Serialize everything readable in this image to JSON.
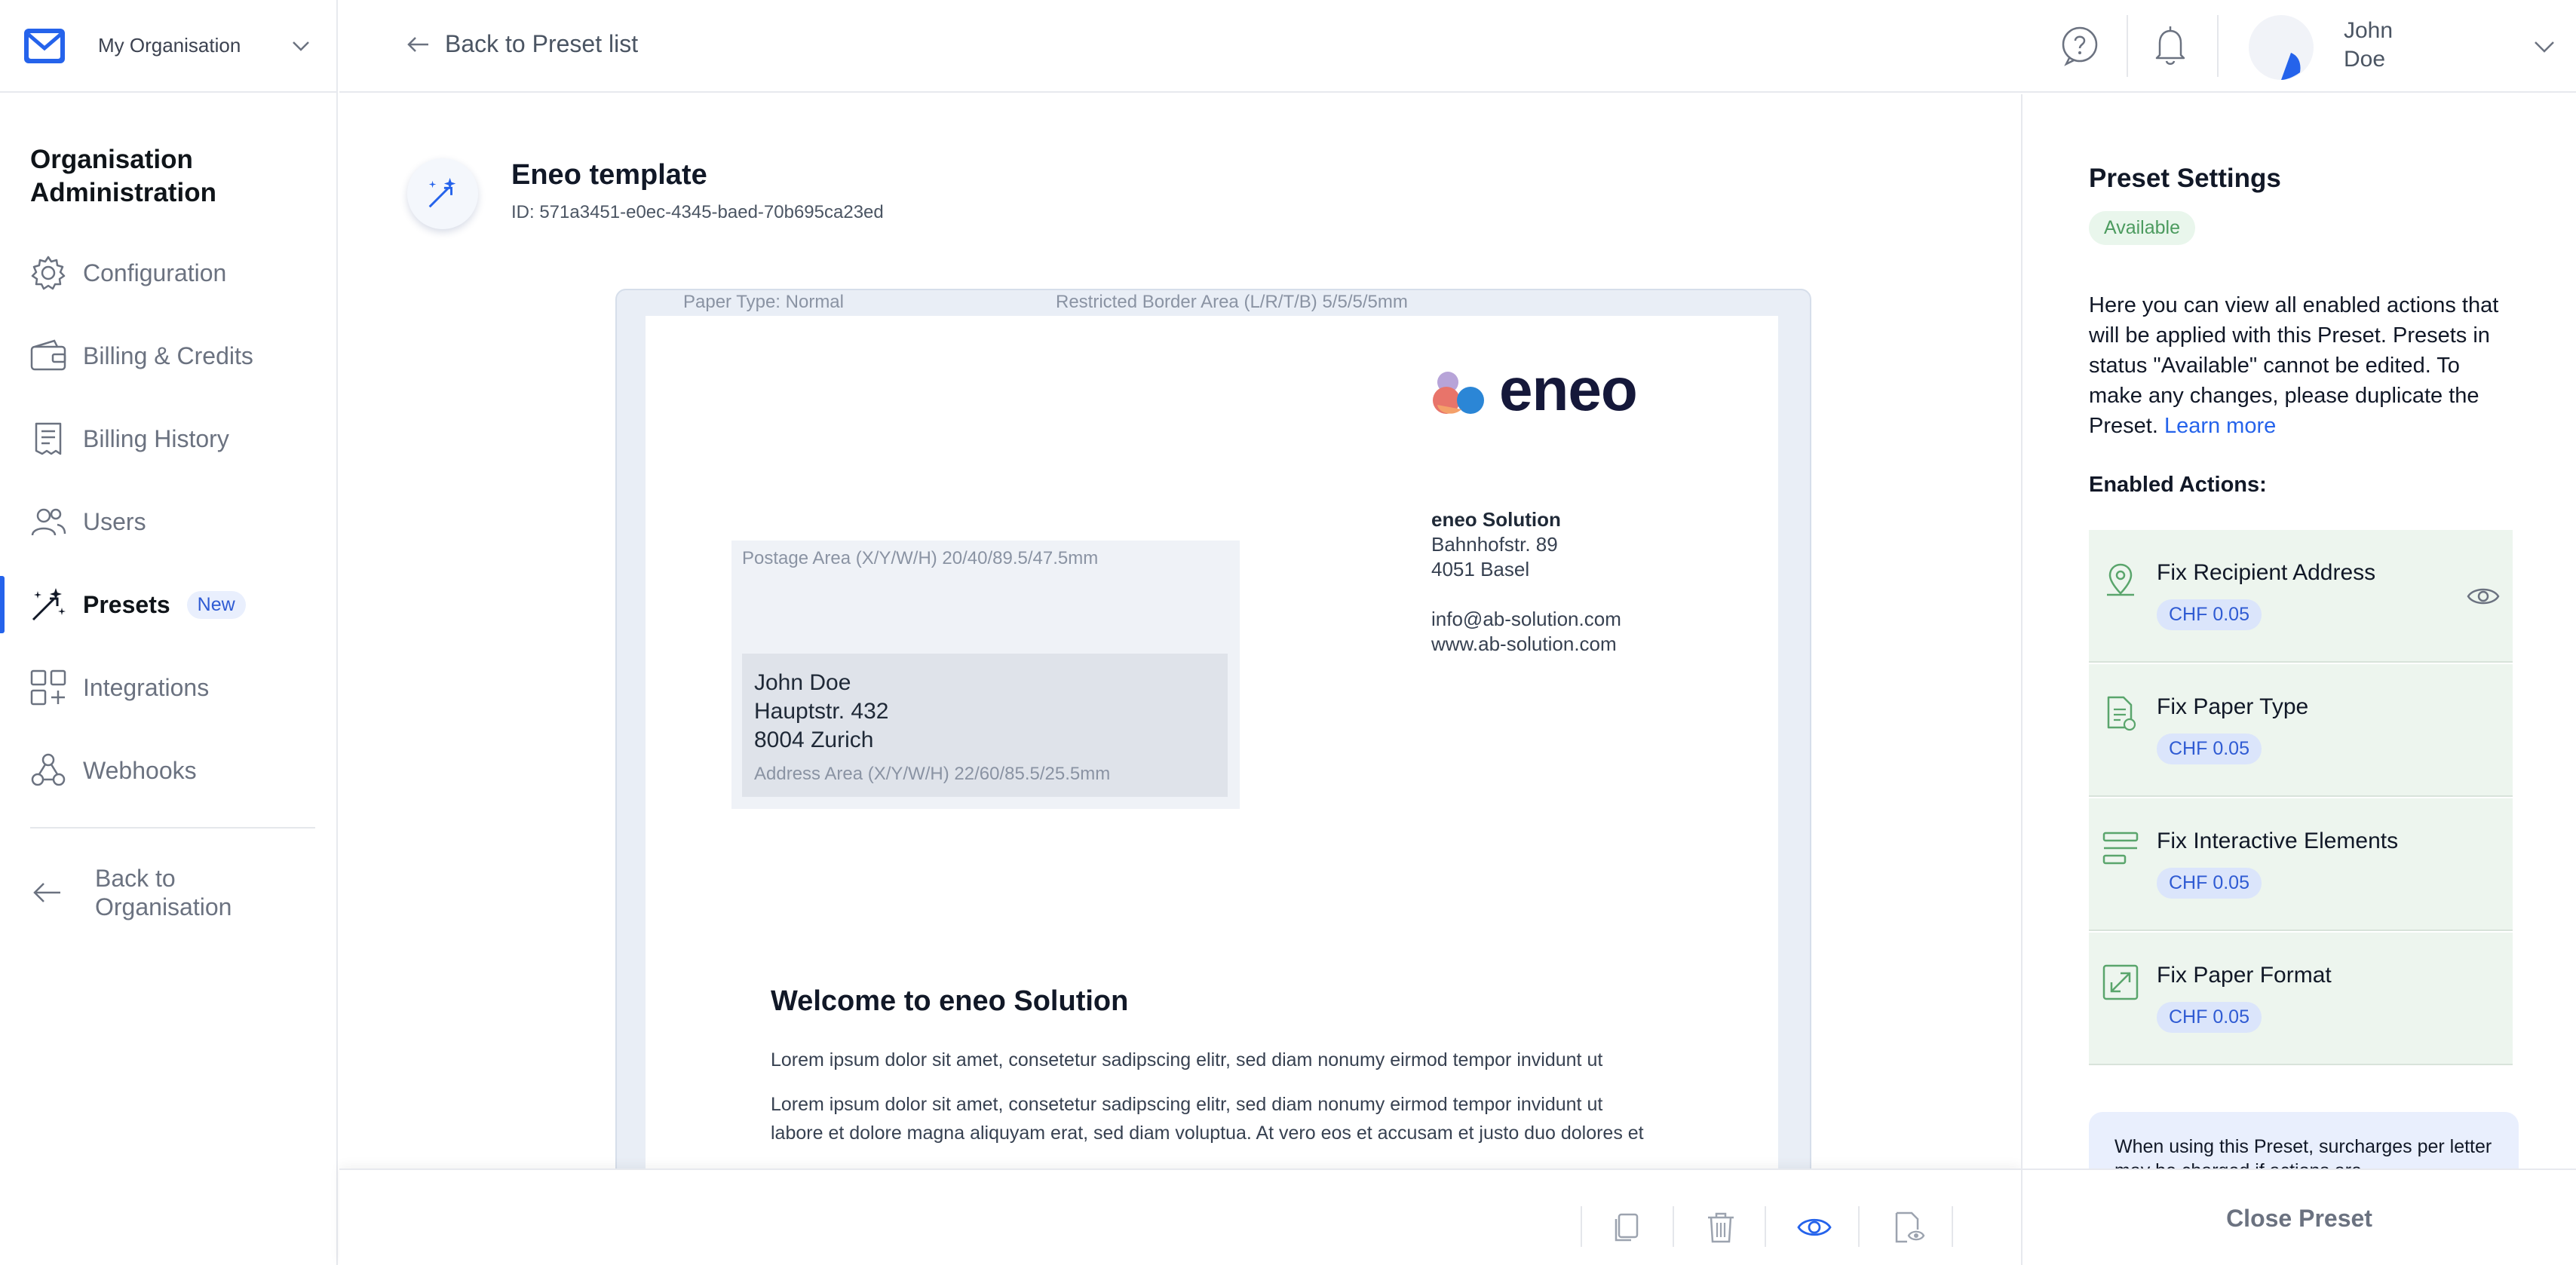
{
  "sidebar": {
    "org_name": "My Organisation",
    "section_title": "Organisation Administration",
    "items": [
      {
        "label": "Configuration",
        "icon": "gear-icon"
      },
      {
        "label": "Billing & Credits",
        "icon": "wallet-icon"
      },
      {
        "label": "Billing History",
        "icon": "receipt-icon"
      },
      {
        "label": "Users",
        "icon": "users-icon"
      },
      {
        "label": "Presets",
        "icon": "magic-wand-icon",
        "badge": "New",
        "active": true
      },
      {
        "label": "Integrations",
        "icon": "grid-plus-icon"
      },
      {
        "label": "Webhooks",
        "icon": "webhook-icon"
      }
    ],
    "back_label": "Back to Organisation"
  },
  "topbar": {
    "back_label": "Back to Preset list",
    "user_name": "John Doe"
  },
  "template": {
    "title": "Eneo template",
    "id_text": "ID: 571a3451-e0ec-4345-baed-70b695ca23ed"
  },
  "document": {
    "paper_type": "Paper Type: Normal",
    "border_area": "Restricted Border Area (L/R/T/B) 5/5/5/5mm",
    "logo_text": "eneo",
    "sender": {
      "name": "eneo Solution",
      "street": "Bahnhofstr. 89",
      "city": "4051 Basel",
      "email": "info@ab-solution.com",
      "web": "www.ab-solution.com"
    },
    "postage_label": "Postage Area (X/Y/W/H) 20/40/89.5/47.5mm",
    "recipient": {
      "name": "John Doe",
      "street": "Hauptstr. 432",
      "city": "8004 Zurich"
    },
    "address_label": "Address Area (X/Y/W/H) 22/60/85.5/25.5mm",
    "heading": "Welcome to eneo Solution",
    "para1": "Lorem ipsum dolor sit amet, consetetur sadipscing elitr, sed diam nonumy eirmod tempor invidunt ut",
    "para2_line1": "Lorem ipsum dolor sit amet, consetetur sadipscing elitr, sed diam nonumy eirmod tempor invidunt ut",
    "para2_line2": "labore et dolore magna aliquyam erat, sed diam voluptua. At vero eos et accusam et justo duo dolores et"
  },
  "toolbar": {
    "buttons": [
      "duplicate-icon",
      "trash-icon",
      "eye-icon",
      "file-preview-icon"
    ]
  },
  "panel": {
    "title": "Preset Settings",
    "status": "Available",
    "description": "Here you can view all enabled actions that will be applied with this Preset. Presets in status \"Available\" cannot be edited. To make any changes, please duplicate the Preset.",
    "learn_more": "Learn more",
    "enabled_title": "Enabled Actions:",
    "actions": [
      {
        "name": "Fix Recipient Address",
        "price": "CHF 0.05",
        "icon": "map-pin-icon"
      },
      {
        "name": "Fix Paper Type",
        "price": "CHF 0.05",
        "icon": "document-icon"
      },
      {
        "name": "Fix Interactive Elements",
        "price": "CHF 0.05",
        "icon": "form-elements-icon"
      },
      {
        "name": "Fix Paper Format",
        "price": "CHF 0.05",
        "icon": "expand-icon"
      }
    ],
    "note": "When using this Preset, surcharges per letter may be charged if actions are",
    "close_label": "Close Preset"
  },
  "colors": {
    "accent": "#2563eb",
    "status_green": "#4c9b5f",
    "action_bg": "#edf5ee",
    "price_badge_bg": "#dbe5fb"
  }
}
